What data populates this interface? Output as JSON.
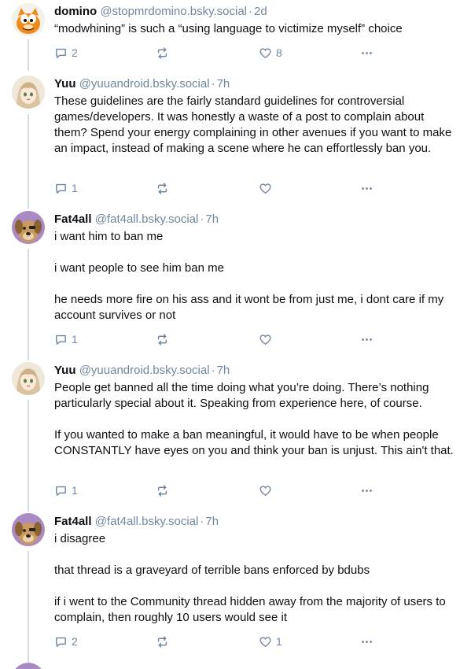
{
  "posts": [
    {
      "name": "domino",
      "handle": "@stopmrdomino.bsky.social",
      "time": "2d",
      "paragraphs": [
        "“modwhining” is such a “using language to victimize myself” choice"
      ],
      "replies": "2",
      "reposts": "",
      "likes": "8",
      "avatar": "garfield-avatar"
    },
    {
      "name": "Yuu",
      "handle": "@yuuandroid.bsky.social",
      "time": "7h",
      "paragraphs": [
        "These guidelines are the fairly standard guidelines for controversial games/developers. It was honestly a waste of a post to complain about them? Spend your energy complaining in other avenues if you want to make an impact, instead of making a scene where he can effortlessly ban you."
      ],
      "replies": "1",
      "reposts": "",
      "likes": "",
      "avatar": "anime-avatar"
    },
    {
      "name": "Fat4all",
      "handle": "@fat4all.bsky.social",
      "time": "7h",
      "paragraphs": [
        "i want him to ban me",
        "i want people to see him ban me",
        "he needs more fire on his ass and it wont be from just me, i dont care if my account survives or not"
      ],
      "replies": "1",
      "reposts": "",
      "likes": "",
      "avatar": "dog-avatar"
    },
    {
      "name": "Yuu",
      "handle": "@yuuandroid.bsky.social",
      "time": "7h",
      "paragraphs": [
        "People get banned all the time doing what you’re doing. There’s nothing particularly special about it. Speaking from experience here, of course.",
        "If you wanted to make a ban meaningful, it would have to be when people CONSTANTLY have eyes on you and think your ban is unjust. This ain't that."
      ],
      "replies": "1",
      "reposts": "",
      "likes": "",
      "avatar": "anime-avatar"
    },
    {
      "name": "Fat4all",
      "handle": "@fat4all.bsky.social",
      "time": "7h",
      "paragraphs": [
        "i disagree",
        "that thread is a graveyard of terrible bans enforced by bdubs",
        "if i went to the Community thread hidden away from the majority of users to complain, then roughly 10 users would see it"
      ],
      "replies": "2",
      "reposts": "",
      "likes": "1",
      "avatar": "dog-avatar"
    }
  ],
  "separator": "·",
  "colors": {
    "muted": "#6f869f",
    "text": "#0b0f14",
    "line": "#d4dbe2"
  }
}
